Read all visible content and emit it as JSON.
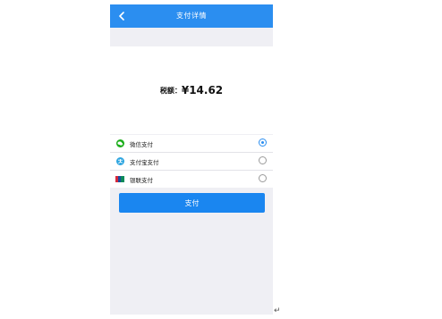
{
  "header": {
    "title": "支付详情"
  },
  "amount": {
    "label": "税额：",
    "value": "¥14.62"
  },
  "methods": [
    {
      "label": "微信支付",
      "selected": true
    },
    {
      "label": "支付宝支付",
      "selected": false
    },
    {
      "label": "银联支付",
      "selected": false
    }
  ],
  "pay_button": {
    "label": "支付"
  },
  "colors": {
    "primary": "#2b8ef0",
    "page_bg": "#efeff4"
  }
}
